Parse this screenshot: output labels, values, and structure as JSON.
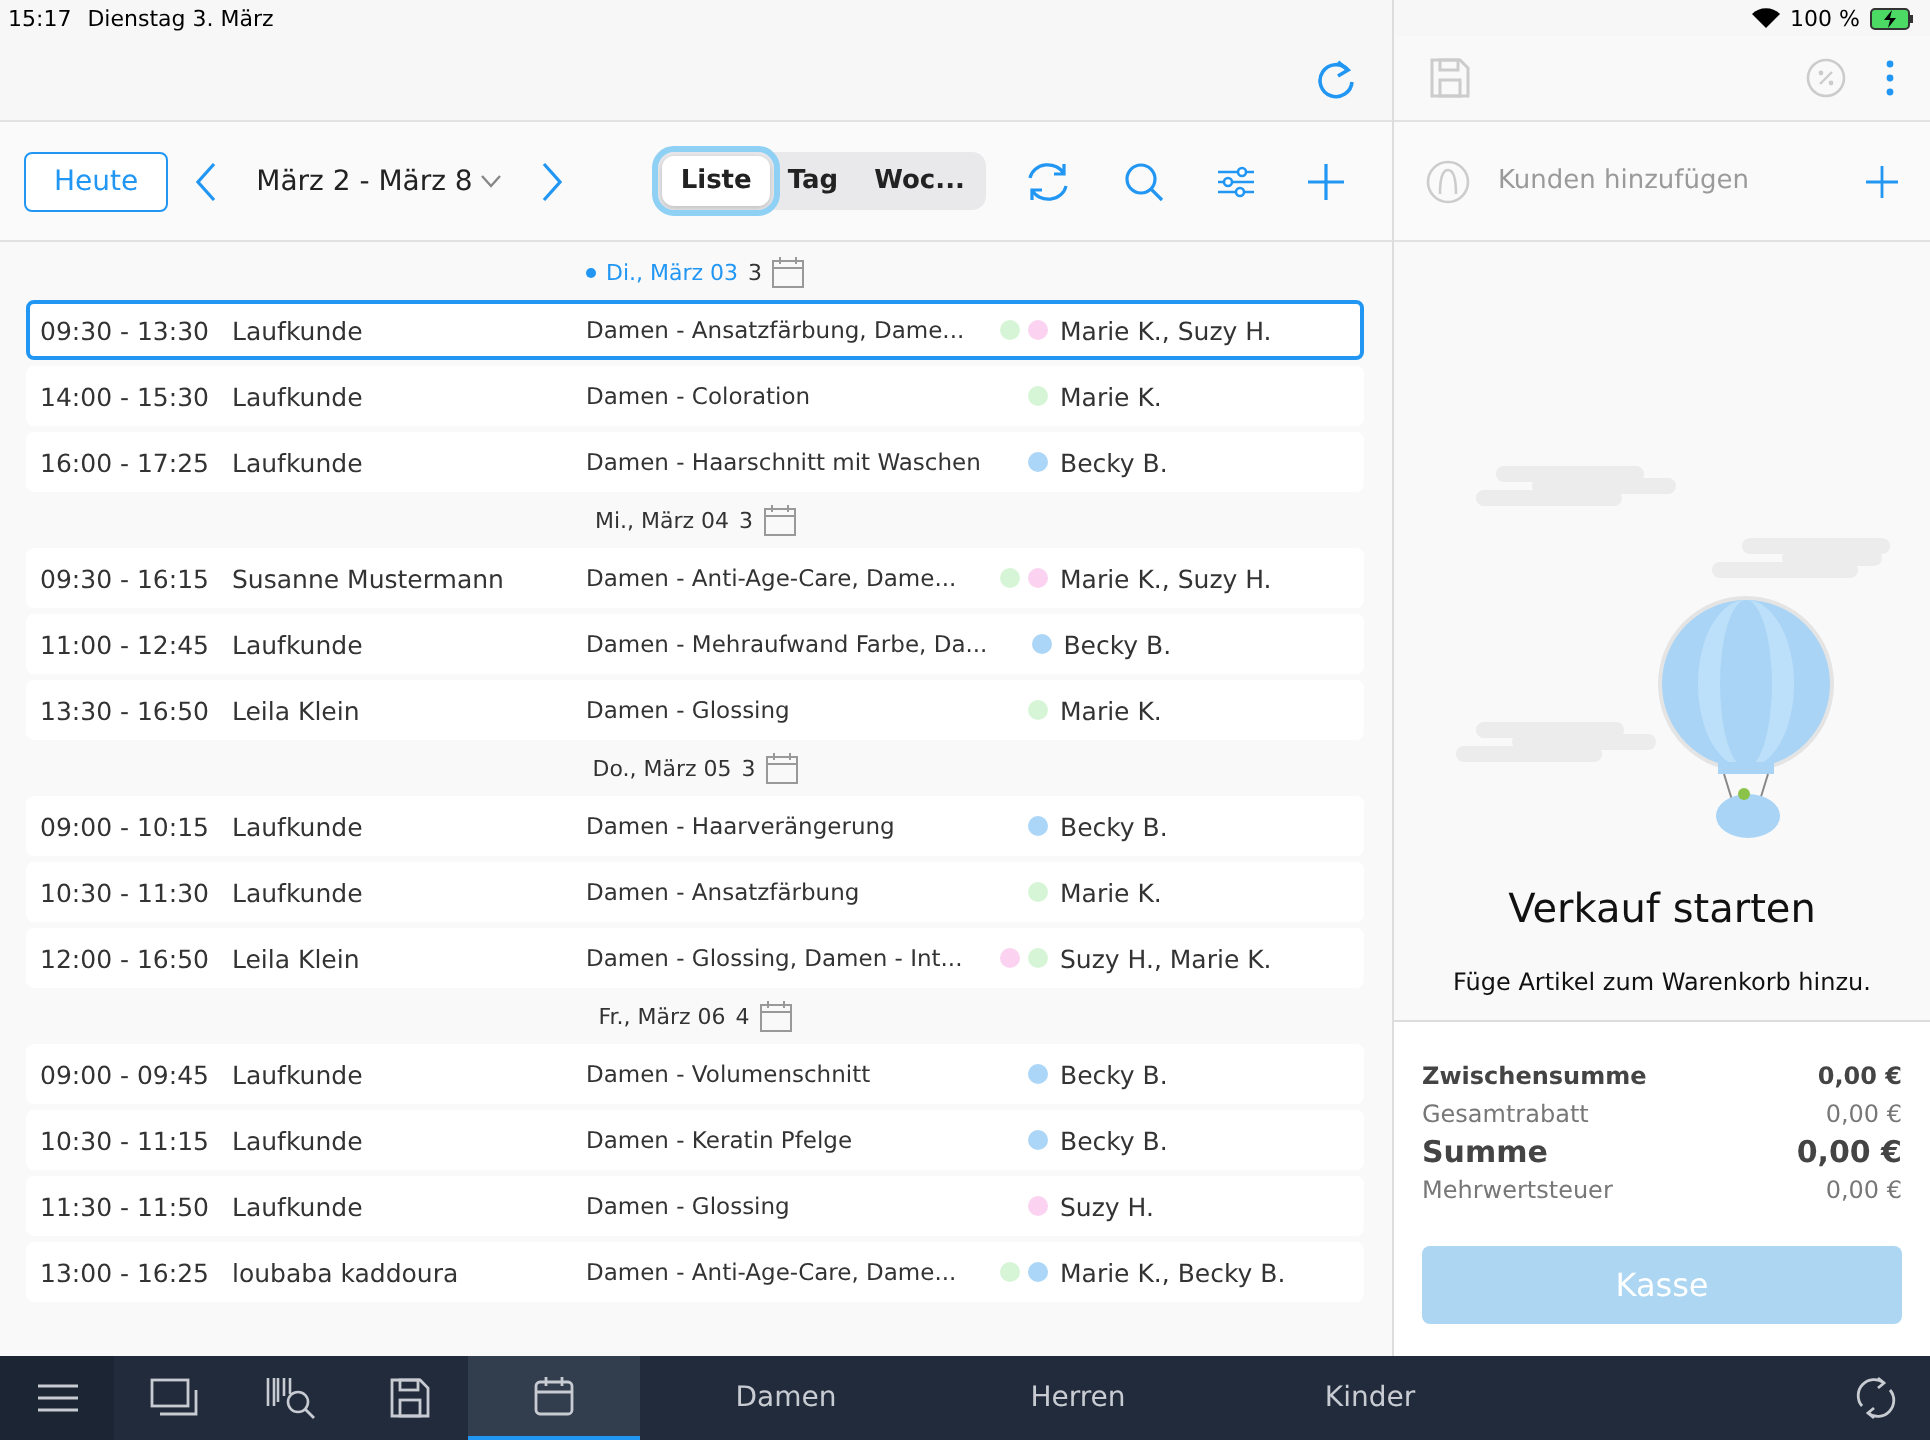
{
  "status_bar": {
    "time": "15:17",
    "date": "Dienstag 3. März",
    "battery": "100 %"
  },
  "toolbar": {
    "today_button": "Heute",
    "range": "März 2 - März 8",
    "views": [
      {
        "label": "Liste",
        "selected": true
      },
      {
        "label": "Tag",
        "selected": false
      },
      {
        "label": "Woc...",
        "selected": false
      }
    ]
  },
  "days": [
    {
      "label": "Di., März 03",
      "count": "3",
      "selected": true,
      "rows": [
        {
          "time": "09:30 - 13:30",
          "customer": "Laufkunde",
          "service": "Damen - Ansatzfärbung, Dame...",
          "dots": [
            {
              "color": "#d6f5d6"
            },
            {
              "color": "#fbd3f1"
            }
          ],
          "staff": "Marie K., Suzy H.",
          "selected": true
        },
        {
          "time": "14:00 - 15:30",
          "customer": "Laufkunde",
          "service": "Damen - Coloration",
          "dots": [
            {
              "color": "#d6f5d6"
            }
          ],
          "staff": "Marie K.",
          "selected": false
        },
        {
          "time": "16:00 - 17:25",
          "customer": "Laufkunde",
          "service": "Damen - Haarschnitt mit Waschen",
          "dots": [
            {
              "color": "#abd6f7"
            }
          ],
          "staff": "Becky B.",
          "selected": false
        }
      ]
    },
    {
      "label": "Mi., März 04",
      "count": "3",
      "selected": false,
      "rows": [
        {
          "time": "09:30 - 16:15",
          "customer": "Susanne Mustermann",
          "service": "Damen - Anti-Age-Care, Dame...",
          "dots": [
            {
              "color": "#d6f5d6"
            },
            {
              "color": "#fbd3f1"
            }
          ],
          "staff": "Marie K., Suzy H.",
          "selected": false
        },
        {
          "time": "11:00 - 12:45",
          "customer": "Laufkunde",
          "service": "Damen - Mehraufwand Farbe, Da...",
          "dots": [
            {
              "color": "#abd6f7"
            }
          ],
          "staff": "Becky B.",
          "selected": false
        },
        {
          "time": "13:30 - 16:50",
          "customer": "Leila Klein",
          "service": "Damen - Glossing",
          "dots": [
            {
              "color": "#d6f5d6"
            }
          ],
          "staff": "Marie K.",
          "selected": false
        }
      ]
    },
    {
      "label": "Do., März 05",
      "count": "3",
      "selected": false,
      "rows": [
        {
          "time": "09:00 - 10:15",
          "customer": "Laufkunde",
          "service": "Damen - Haarverängerung",
          "dots": [
            {
              "color": "#abd6f7"
            }
          ],
          "staff": "Becky B.",
          "selected": false
        },
        {
          "time": "10:30 - 11:30",
          "customer": "Laufkunde",
          "service": "Damen - Ansatzfärbung",
          "dots": [
            {
              "color": "#d6f5d6"
            }
          ],
          "staff": "Marie K.",
          "selected": false
        },
        {
          "time": "12:00 - 16:50",
          "customer": "Leila Klein",
          "service": "Damen - Glossing, Damen - Int...",
          "dots": [
            {
              "color": "#fbd3f1"
            },
            {
              "color": "#d6f5d6"
            }
          ],
          "staff": "Suzy H., Marie K.",
          "selected": false
        }
      ]
    },
    {
      "label": "Fr., März 06",
      "count": "4",
      "selected": false,
      "rows": [
        {
          "time": "09:00 - 09:45",
          "customer": "Laufkunde",
          "service": "Damen - Volumenschnitt",
          "dots": [
            {
              "color": "#abd6f7"
            }
          ],
          "staff": "Becky B.",
          "selected": false
        },
        {
          "time": "10:30 - 11:15",
          "customer": "Laufkunde",
          "service": "Damen - Keratin Pfelge",
          "dots": [
            {
              "color": "#abd6f7"
            }
          ],
          "staff": "Becky B.",
          "selected": false
        },
        {
          "time": "11:30 - 11:50",
          "customer": "Laufkunde",
          "service": "Damen - Glossing",
          "dots": [
            {
              "color": "#fbd3f1"
            }
          ],
          "staff": "Suzy H.",
          "selected": false
        },
        {
          "time": "13:00 - 16:25",
          "customer": "loubaba kaddoura",
          "service": "Damen - Anti-Age-Care, Dame...",
          "dots": [
            {
              "color": "#d6f5d6"
            },
            {
              "color": "#abd6f7"
            }
          ],
          "staff": "Marie K., Becky B.",
          "selected": false
        }
      ]
    }
  ],
  "cart": {
    "customer_placeholder": "Kunden hinzufügen",
    "title": "Verkauf starten",
    "hint": "Füge Artikel zum Warenkorb hinzu.",
    "totals": [
      {
        "label": "Zwischensumme",
        "value": "0,00 €",
        "kind": "bold"
      },
      {
        "label": "Gesamtrabatt",
        "value": "0,00 €",
        "kind": "plain"
      },
      {
        "label": "Summe",
        "value": "0,00 €",
        "kind": "total"
      },
      {
        "label": "Mehrwertsteuer",
        "value": "0,00 €",
        "kind": "plain"
      }
    ],
    "checkout_button": "Kasse",
    "checkout_disabled": true
  },
  "bottom_bar": {
    "icons": [
      {
        "kind": "screens",
        "selected": false
      },
      {
        "kind": "barcode",
        "selected": false
      },
      {
        "kind": "save",
        "selected": false
      },
      {
        "kind": "calendar",
        "selected": true
      }
    ],
    "categories": [
      "Damen",
      "Herren",
      "Kinder"
    ]
  }
}
